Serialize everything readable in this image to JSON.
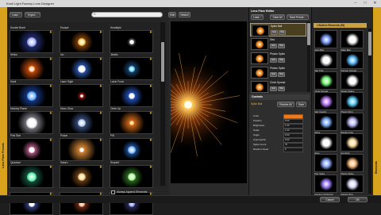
{
  "window": {
    "title": "Knoll Light Factory Lens Designer",
    "min": "–",
    "max": "□",
    "close": "✕"
  },
  "left": {
    "load_label": "Load...",
    "export_label": "Export...",
    "search_placeholder": "",
    "presets_tab": "Lens Flare Presets",
    "presets": [
      "Double Bezel",
      "Escape",
      "Headlight",
      "Helios",
      "Ion",
      "Jewels",
      "Kami",
      "Laser Sight",
      "Lunar Force",
      "Monkey Planet",
      "Moon Glow",
      "Order Up",
      "Pink Star",
      "Pulsar",
      "PW",
      "Quantum",
      "Saturn",
      "Serpent",
      "",
      "",
      ""
    ],
    "always_append_label": "Always Append Elements"
  },
  "preview": {
    "hide_label": "Hide",
    "nested_label": "Nested"
  },
  "editor": {
    "title": "Lens Flare Editor",
    "load_label": "Load...",
    "clear_all_label": "Clear All",
    "save_preset_label": "Save Preset...",
    "layers": [
      {
        "name": "Spike Ball",
        "selected": true
      },
      {
        "name": "Disc",
        "selected": false
      },
      {
        "name": "Photon Spike",
        "selected": false
      },
      {
        "name": "Photon Spike",
        "selected": false
      },
      {
        "name": "Circle Spread",
        "selected": false
      }
    ],
    "mini_labels": [
      "Solo",
      "Hide"
    ]
  },
  "controls": {
    "title": "Controls",
    "element_name": "Spike Ball",
    "restore_label": "Restore All",
    "save_label": "Save",
    "rows": [
      {
        "label": "Color",
        "value": ""
      },
      {
        "label": "Position",
        "value": "0.00"
      },
      {
        "label": "Brightness",
        "value": "1.00"
      },
      {
        "label": "Scale",
        "value": "1.00"
      },
      {
        "label": "Angle",
        "value": "0.00"
      },
      {
        "label": "Anamorphic",
        "value": "0.00"
      },
      {
        "label": "Spike Count",
        "value": "70"
      },
      {
        "label": "Random Seed",
        "value": "0"
      }
    ],
    "color_swatch": "#f07a1a"
  },
  "elements": {
    "header": "Built-In Elements (35)",
    "tab": "Elements",
    "items": [
      "Glow Ball",
      "Spike Ball",
      "Star Trail",
      "Polygon Spread",
      "Circle Spread",
      "Streak Spikes",
      "Star Caustic",
      "Photon Ring",
      "Stripe",
      "Random Fan",
      "Glow",
      "Hot Glow",
      "Poly Spike",
      "Photon Spike",
      "Aperture Reflection",
      "Caustic Ring"
    ]
  },
  "footer": {
    "cancel_label": "Cancel",
    "ok_label": "OK"
  },
  "colors": {
    "accent": "#e8a418",
    "panel": "#2b2b2b",
    "background": "#1e1e1e"
  }
}
